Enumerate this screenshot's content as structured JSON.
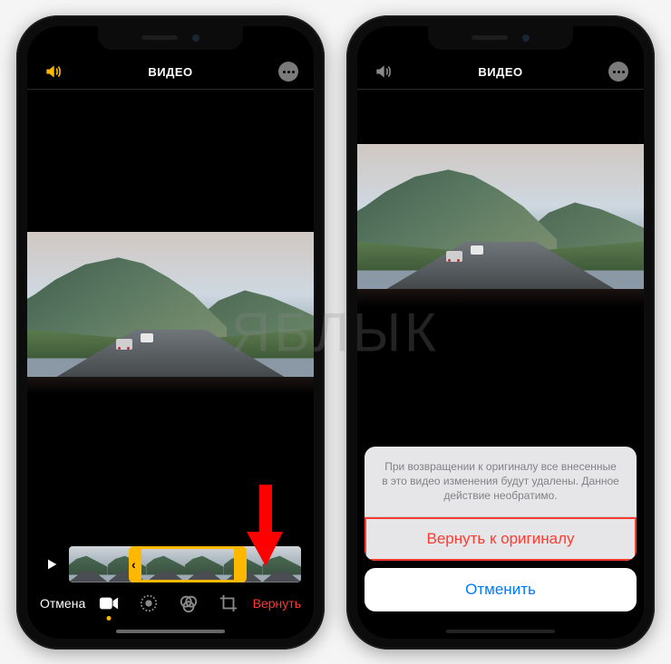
{
  "watermark": "ЯБЛЫК",
  "header": {
    "title": "ВИДЕО"
  },
  "toolbar": {
    "cancel_label": "Отмена",
    "revert_label": "Вернуть"
  },
  "icons": {
    "volume": "volume-icon",
    "volume_muted": "volume-muted-icon",
    "more": "more-icon",
    "play": "play-icon",
    "video": "video-tool-icon",
    "adjust": "adjust-tool-icon",
    "filters": "filters-tool-icon",
    "crop": "crop-tool-icon"
  },
  "sheet": {
    "message": "При возвращении к оригиналу все внесенные в это видео изменения будут удалены. Данное действие необратимо.",
    "revert_label": "Вернуть к оригиналу",
    "cancel_label": "Отменить"
  }
}
